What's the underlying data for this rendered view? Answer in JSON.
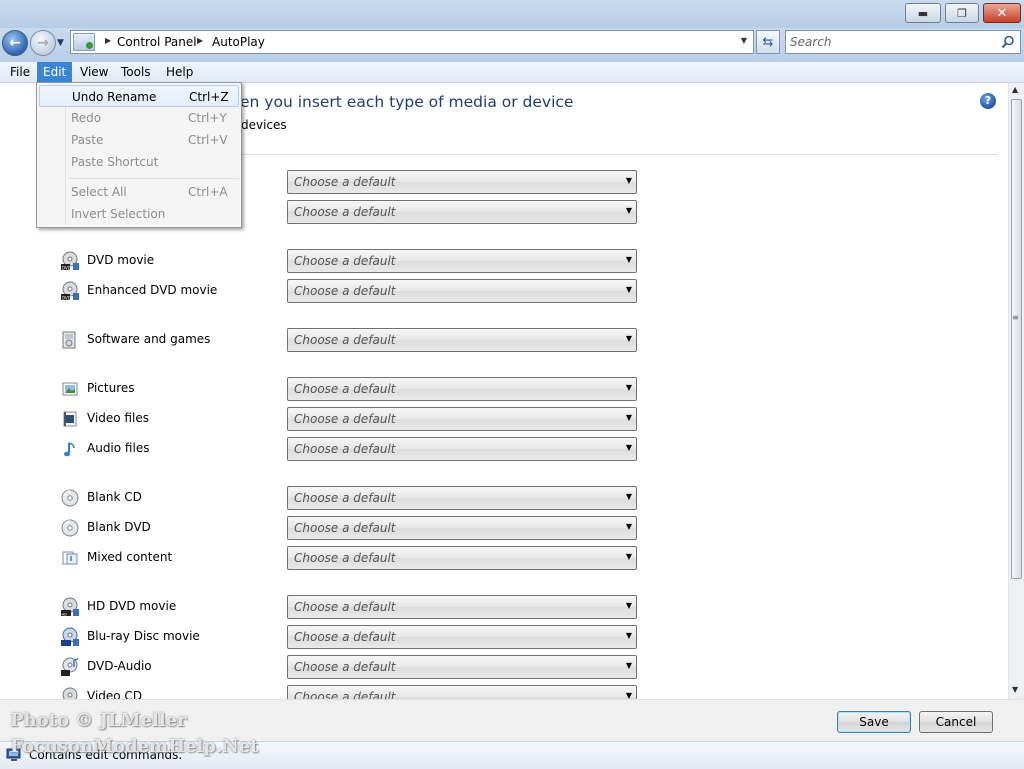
{
  "window": {
    "minimize_glyph": "▬",
    "maximize_glyph": "❐",
    "close_glyph": "✕"
  },
  "nav": {
    "back_glyph": "←",
    "forward_glyph": "→",
    "history_glyph": "▼",
    "address_icon": "control-panel-icon",
    "breadcrumb": [
      "Control Panel",
      "AutoPlay"
    ],
    "separator_glyph": "▶",
    "address_dropdown_glyph": "▼",
    "refresh_glyph": "⇆",
    "search_placeholder": "Search",
    "search_icon": "magnifier-icon"
  },
  "menubar": {
    "items": [
      "File",
      "Edit",
      "View",
      "Tools",
      "Help"
    ],
    "active": "Edit"
  },
  "edit_menu": {
    "items": [
      {
        "label": "Undo Rename",
        "shortcut": "Ctrl+Z",
        "enabled": true
      },
      {
        "label": "Redo",
        "shortcut": "Ctrl+Y",
        "enabled": false
      },
      {
        "label": "Paste",
        "shortcut": "Ctrl+V",
        "enabled": false
      },
      {
        "label": "Paste Shortcut",
        "shortcut": "",
        "enabled": false
      },
      {
        "label": "Select All",
        "shortcut": "Ctrl+A",
        "enabled": false
      },
      {
        "label": "Invert Selection",
        "shortcut": "",
        "enabled": false
      }
    ]
  },
  "content": {
    "heading_visible": "en you insert each type of media or device",
    "subtext_visible": "devices",
    "help_glyph": "?",
    "combo_value": "Choose a default",
    "combo_arrow": "▼",
    "hidden_rows": 2,
    "rows": [
      {
        "label": "DVD movie",
        "icon": "dvd-movie-icon"
      },
      {
        "label": "Enhanced DVD movie",
        "icon": "dvd-movie-icon"
      },
      {
        "label": "Software and games",
        "icon": "software-icon"
      },
      {
        "label": "Pictures",
        "icon": "pictures-icon"
      },
      {
        "label": "Video files",
        "icon": "video-files-icon"
      },
      {
        "label": "Audio files",
        "icon": "audio-files-icon"
      },
      {
        "label": "Blank CD",
        "icon": "blank-disc-icon"
      },
      {
        "label": "Blank DVD",
        "icon": "blank-disc-icon"
      },
      {
        "label": "Mixed content",
        "icon": "mixed-content-icon"
      },
      {
        "label": "HD DVD movie",
        "icon": "hd-dvd-icon"
      },
      {
        "label": "Blu-ray Disc movie",
        "icon": "bluray-icon"
      },
      {
        "label": "DVD-Audio",
        "icon": "dvd-audio-icon"
      },
      {
        "label": "Video CD",
        "icon": "video-cd-icon"
      }
    ]
  },
  "buttons": {
    "save": "Save",
    "cancel": "Cancel"
  },
  "status": {
    "text": "Contains edit commands.",
    "icon": "status-computer-icon"
  },
  "watermark": {
    "line1": "Photo © JLMeller",
    "line2": "FocusonModemHelp.Net"
  },
  "colors": {
    "heading": "#1e3f73",
    "menu_active": "#3a86d6",
    "titlebar": "#c9dbee"
  }
}
